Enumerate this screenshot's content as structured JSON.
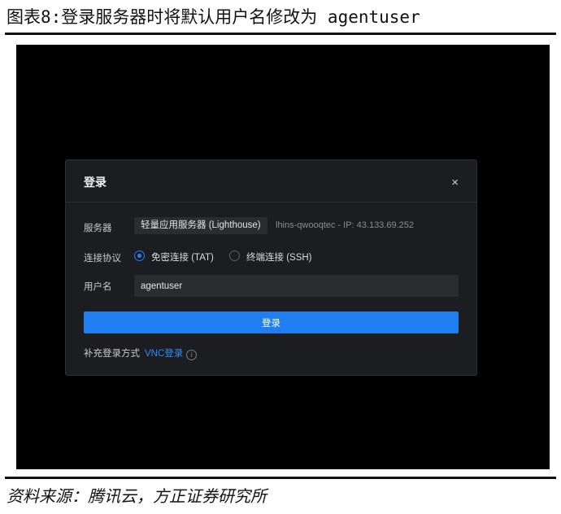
{
  "figure": {
    "title": "图表8:登录服务器时将默认用户名修改为 agentuser",
    "source": "资料来源：腾讯云，方正证券研究所"
  },
  "dialog": {
    "title": "登录",
    "close_glyph": "×",
    "server": {
      "label": "服务器",
      "tag": "轻量应用服务器 (Lighthouse)",
      "info": "lhins-qwooqtec - IP: 43.133.69.252"
    },
    "protocol": {
      "label": "连接协议",
      "options": [
        {
          "label": "免密连接 (TAT)",
          "checked": true
        },
        {
          "label": "终端连接 (SSH)",
          "checked": false
        }
      ]
    },
    "username": {
      "label": "用户名",
      "value": "agentuser"
    },
    "login_button": "登录",
    "extra": {
      "label": "补充登录方式",
      "link": "VNC登录",
      "icon": "info-icon"
    }
  },
  "colors": {
    "screen_bg": "#000000",
    "dialog_bg": "#1c1d20",
    "accent": "#1f7ff0"
  }
}
